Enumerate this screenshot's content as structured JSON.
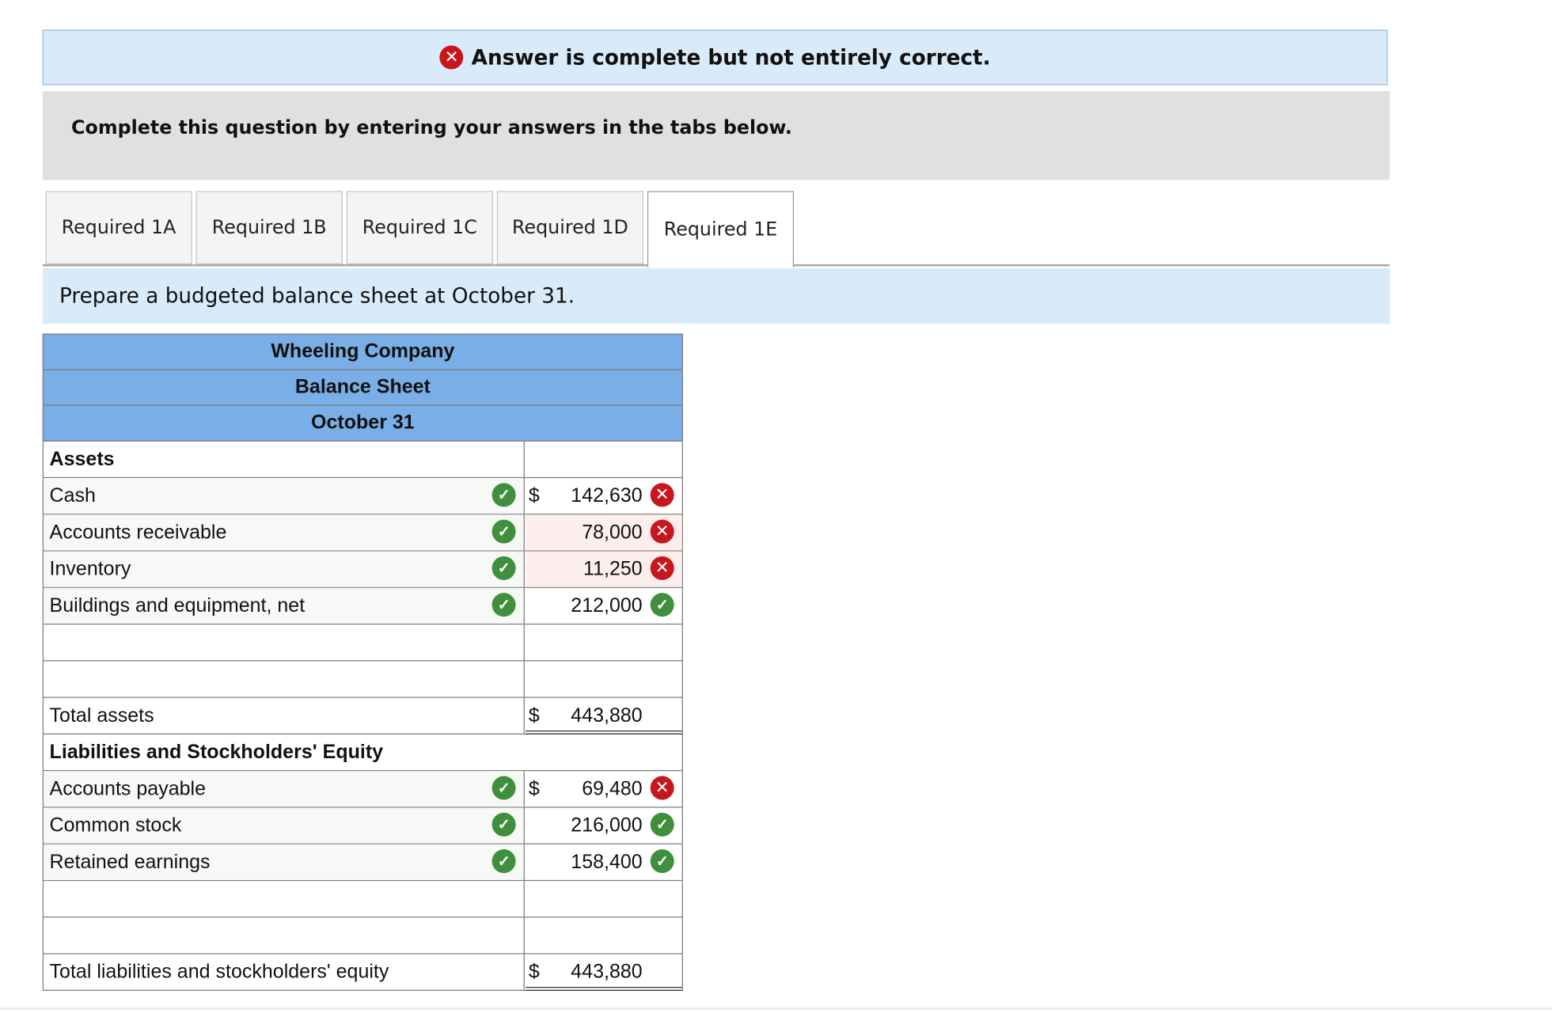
{
  "banner": {
    "message": "Answer is complete but not entirely correct.",
    "icon": "x-circle-icon",
    "icon_color": "#c8161d"
  },
  "instruction": "Complete this question by entering your answers in the tabs below.",
  "tabs": [
    {
      "label": "Required 1A",
      "active": false
    },
    {
      "label": "Required 1B",
      "active": false
    },
    {
      "label": "Required 1C",
      "active": false
    },
    {
      "label": "Required 1D",
      "active": false
    },
    {
      "label": "Required 1E",
      "active": true
    }
  ],
  "prompt": "Prepare a budgeted balance sheet at October 31.",
  "sheet": {
    "company": "Wheeling Company",
    "statement": "Balance Sheet",
    "date": "October 31",
    "assets_heading": "Assets",
    "assets": [
      {
        "label": "Cash",
        "currency": "$",
        "value": "142,630",
        "label_ok": true,
        "value_status": "incorrect"
      },
      {
        "label": "Accounts receivable",
        "currency": "",
        "value": "78,000",
        "label_ok": true,
        "value_status": "incorrect"
      },
      {
        "label": "Inventory",
        "currency": "",
        "value": "11,250",
        "label_ok": true,
        "value_status": "incorrect"
      },
      {
        "label": "Buildings and equipment, net",
        "currency": "",
        "value": "212,000",
        "label_ok": true,
        "value_status": "correct"
      }
    ],
    "total_assets": {
      "label": "Total assets",
      "currency": "$",
      "value": "443,880"
    },
    "liab_heading": "Liabilities and Stockholders' Equity",
    "liabilities": [
      {
        "label": "Accounts payable",
        "currency": "$",
        "value": "69,480",
        "label_ok": true,
        "value_status": "incorrect"
      },
      {
        "label": "Common stock",
        "currency": "",
        "value": "216,000",
        "label_ok": true,
        "value_status": "correct"
      },
      {
        "label": "Retained earnings",
        "currency": "",
        "value": "158,400",
        "label_ok": true,
        "value_status": "correct"
      }
    ],
    "total_liab": {
      "label": "Total liabilities and stockholders' equity",
      "currency": "$",
      "value": "443,880"
    }
  },
  "colors": {
    "correct": "#3f8f3c",
    "incorrect": "#c8161d",
    "header_bg": "#7aaee6",
    "banner_bg": "#d9ebf9"
  }
}
